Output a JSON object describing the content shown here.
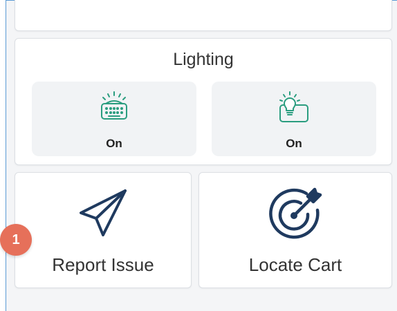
{
  "lighting": {
    "title": "Lighting",
    "tiles": [
      {
        "icon": "keyboard-light-icon",
        "state": "On"
      },
      {
        "icon": "bulb-light-icon",
        "state": "On"
      }
    ]
  },
  "actions": [
    {
      "icon": "send-icon",
      "label": "Report Issue"
    },
    {
      "icon": "target-icon",
      "label": "Locate Cart"
    }
  ],
  "step_badge": {
    "number": "1",
    "color": "#e6705a"
  },
  "colors": {
    "icon_teal": "#2a9d7f",
    "icon_navy": "#1f3a5f",
    "tile_bg": "#f1f3f5",
    "panel_bg": "#f4f5f7"
  }
}
